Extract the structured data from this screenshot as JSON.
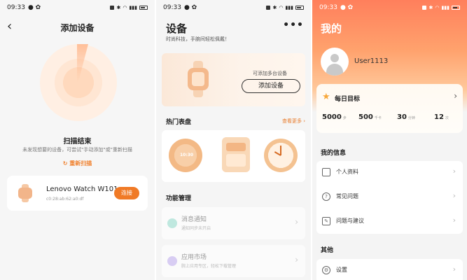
{
  "status": {
    "time": "09:33"
  },
  "scan": {
    "title": "添加设备",
    "done": "扫描结束",
    "hint": "未发现想要的设备，可尝试\"手动添加\"或\"重新扫描",
    "rescan": "重新扫描",
    "device": {
      "name": "Lenovo Watch W101",
      "mac": "c0:28:ab:62:a0:df",
      "connect_label": "连接"
    }
  },
  "devices": {
    "title": "设备",
    "subtitle": "时尚科技，手腕间轻松佩戴！",
    "more_icon": "more-dots-icon",
    "banner_hint": "可添加多台设备",
    "add_label": "添加设备",
    "faces_title": "热门表盘",
    "see_more": "查看更多",
    "face_time": "10:30",
    "func_title": "功能管理",
    "functions": [
      {
        "title": "消息通知",
        "sub": "通知同步未开启",
        "color": "#bfe8df"
      },
      {
        "title": "应用市场",
        "sub": "腕上应用专区，轻松下载管理",
        "color": "#d8cdf3"
      }
    ]
  },
  "profile": {
    "title": "我的",
    "username": "User1113",
    "goal_title": "每日目标",
    "goals": [
      {
        "value": "5000",
        "unit": "步"
      },
      {
        "value": "500",
        "unit": "千卡"
      },
      {
        "value": "30",
        "unit": "分钟"
      },
      {
        "value": "12",
        "unit": "次"
      }
    ],
    "info_title": "我的信息",
    "info_items": [
      {
        "label": "个人资料",
        "icon": "id-card-icon"
      },
      {
        "label": "常见问题",
        "icon": "question-icon"
      },
      {
        "label": "问题与建议",
        "icon": "edit-icon"
      }
    ],
    "other_title": "其他",
    "other_items": [
      {
        "label": "设置",
        "icon": "gear-icon"
      }
    ]
  }
}
